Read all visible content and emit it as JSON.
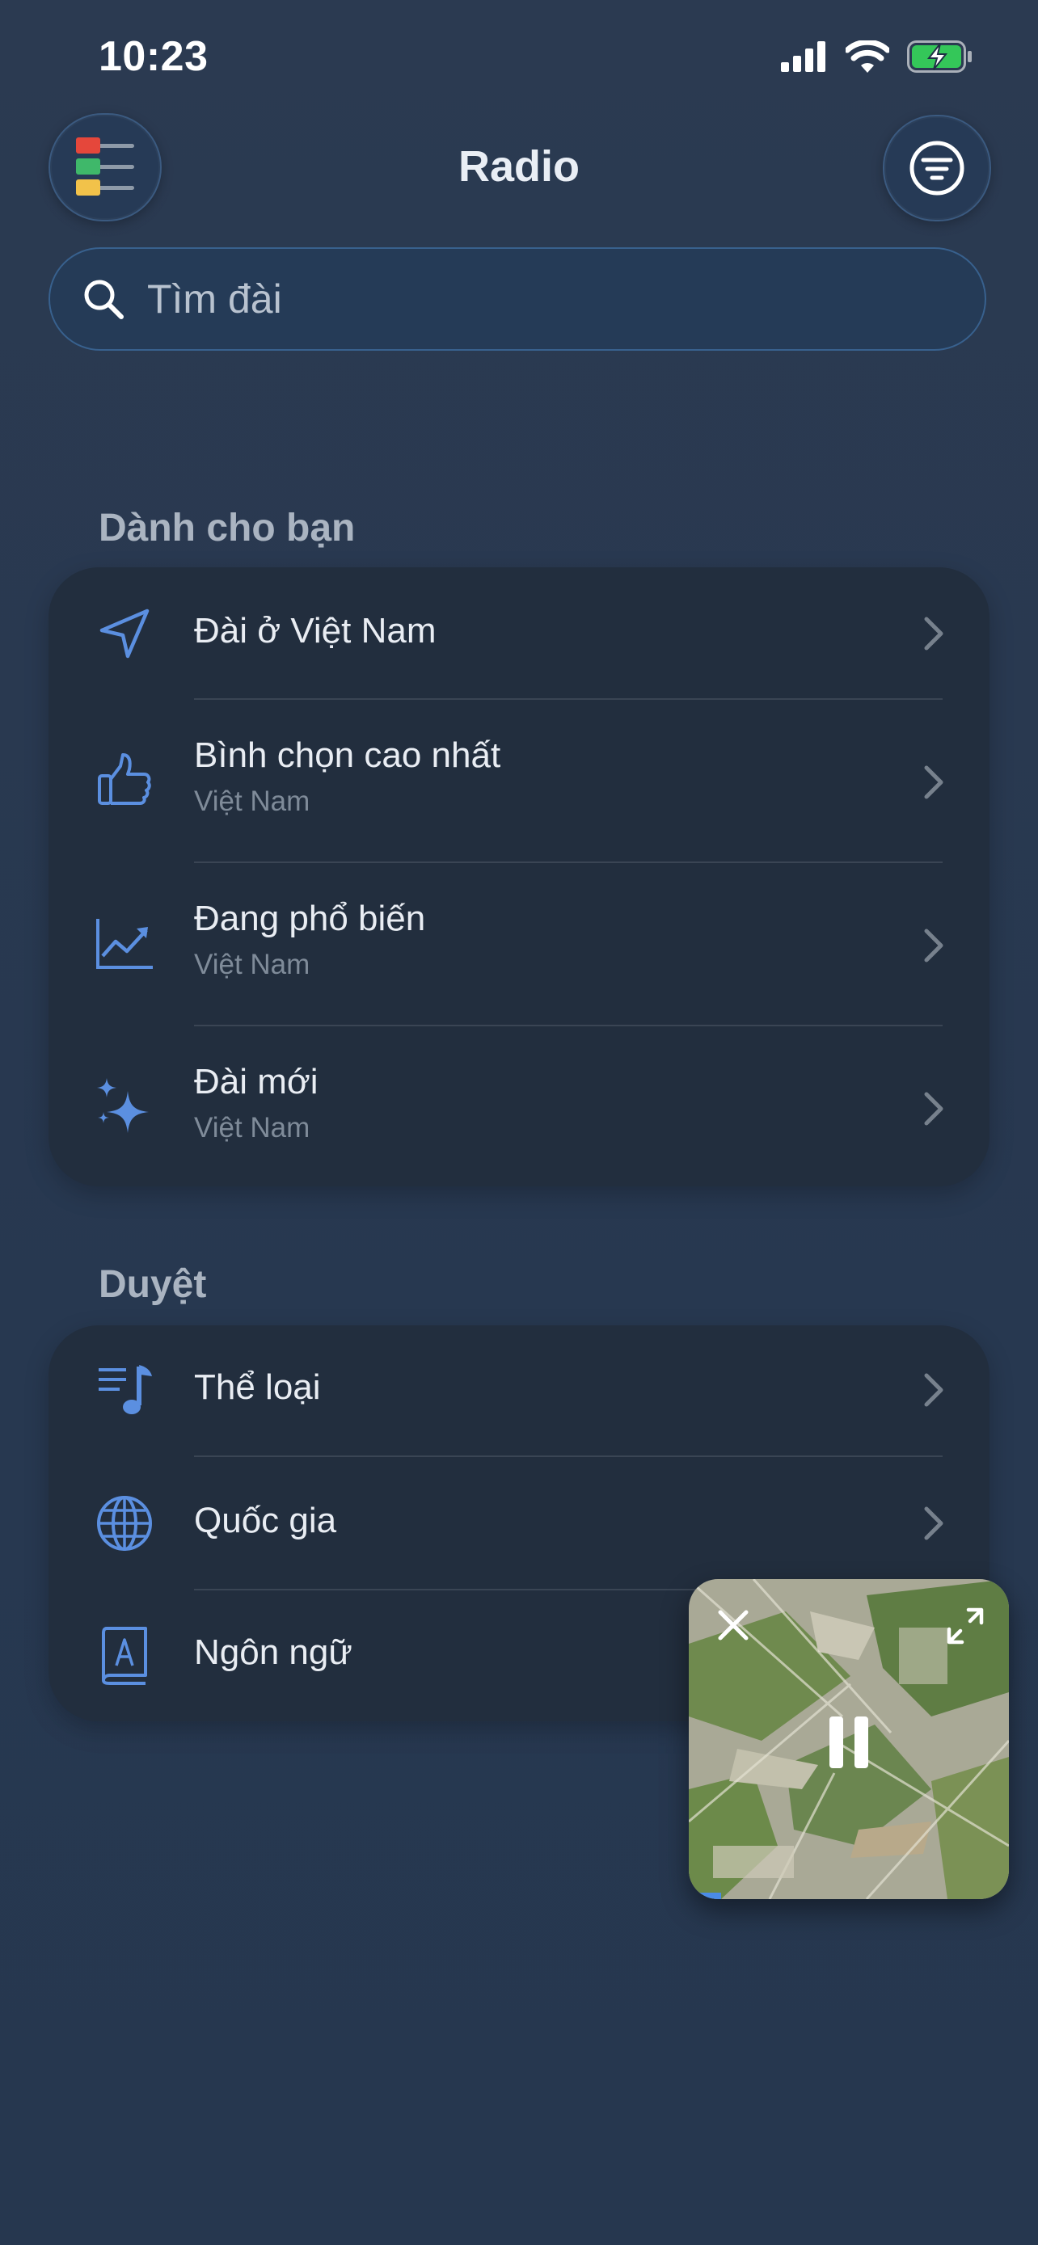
{
  "status": {
    "time": "10:23"
  },
  "header": {
    "title": "Radio"
  },
  "search": {
    "placeholder": "Tìm đài"
  },
  "for_you": {
    "heading": "Dành cho bạn",
    "items": [
      {
        "title": "Đài ở Việt Nam",
        "subtitle": ""
      },
      {
        "title": "Bình chọn cao nhất",
        "subtitle": "Việt Nam"
      },
      {
        "title": "Đang phổ biến",
        "subtitle": "Việt Nam"
      },
      {
        "title": "Đài mới",
        "subtitle": "Việt Nam"
      }
    ]
  },
  "browse": {
    "heading": "Duyệt",
    "items": [
      {
        "title": "Thể loại"
      },
      {
        "title": "Quốc gia"
      },
      {
        "title": "Ngôn ngữ"
      }
    ]
  },
  "icons": {
    "menu": "stoplight-menu-icon",
    "filter": "filter-icon",
    "search": "search-icon",
    "location": "location-arrow-icon",
    "thumbs_up": "thumbs-up-icon",
    "trending": "trending-chart-icon",
    "sparkles": "sparkles-icon",
    "genre": "music-list-icon",
    "country": "globe-icon",
    "language": "language-book-icon",
    "close": "close-icon",
    "expand": "expand-icon",
    "pause": "pause-icon"
  },
  "colors": {
    "accent": "#5b8fe0",
    "background": "#283950",
    "card": "#222e3e",
    "battery_green": "#34c759"
  }
}
